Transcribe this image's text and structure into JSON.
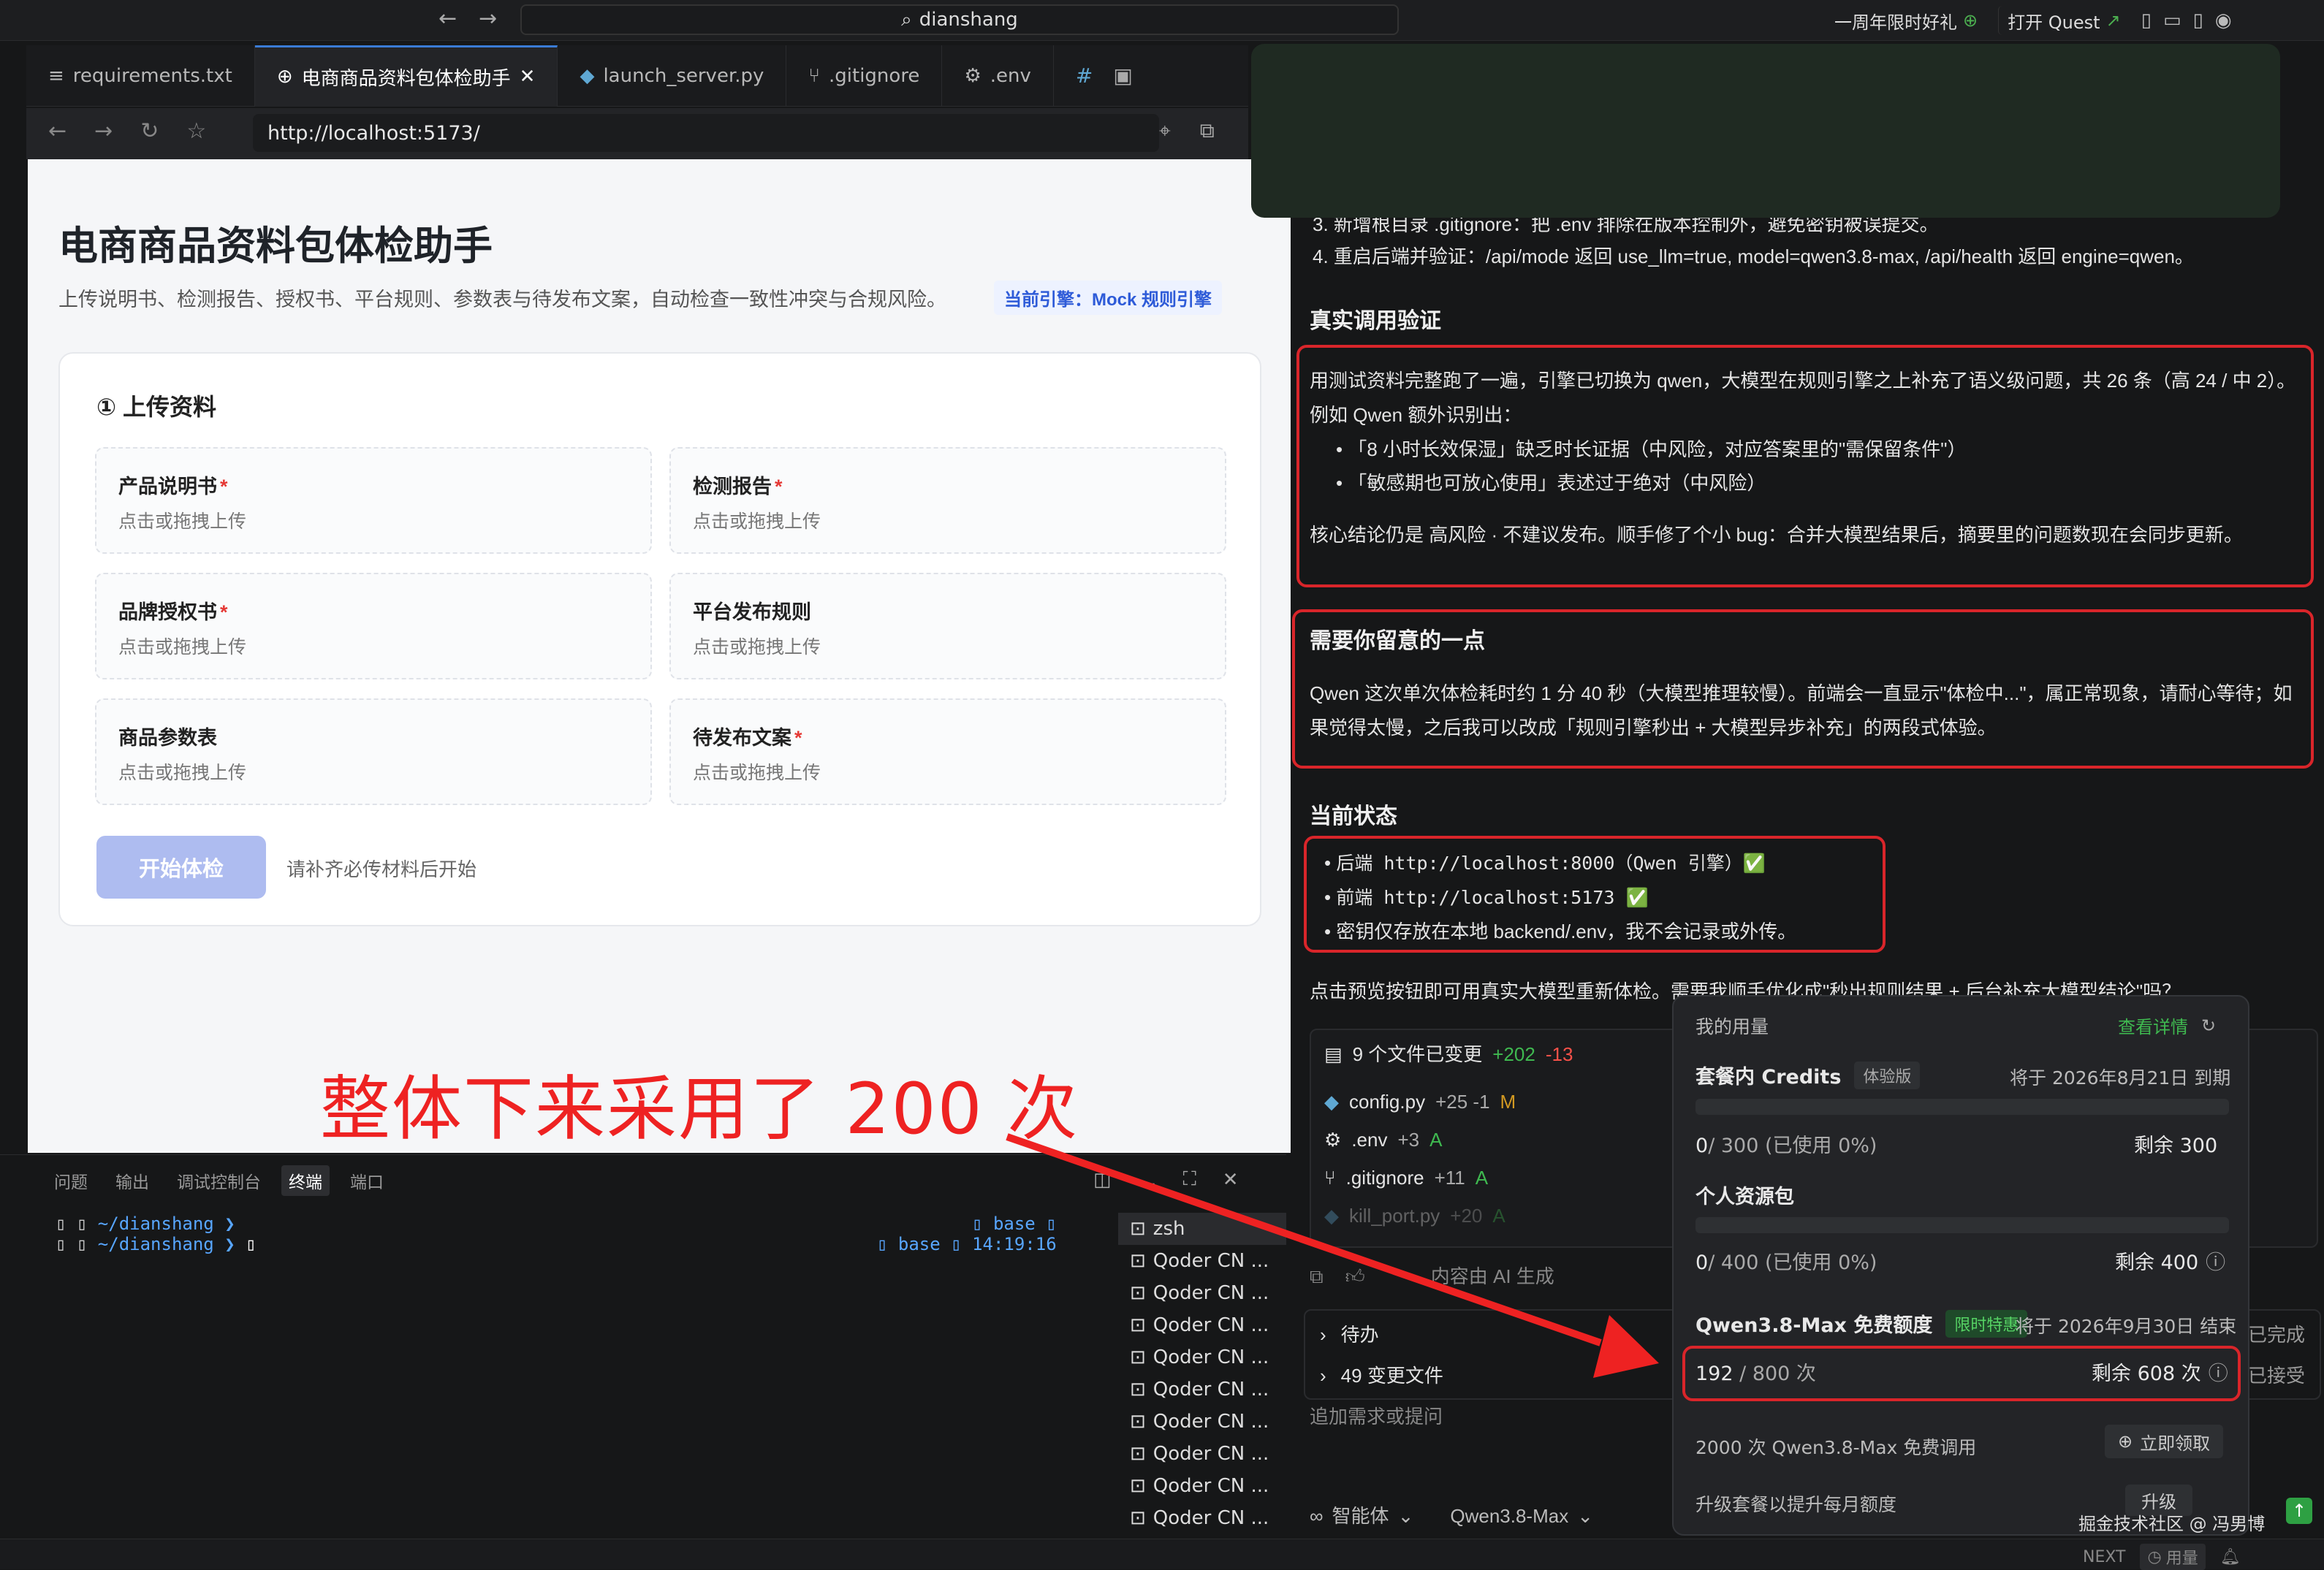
{
  "titlebar": {
    "search": "dianshang",
    "promo": "一周年限时好礼",
    "open_quest": "打开 Quest"
  },
  "tabs": [
    {
      "label": "requirements.txt"
    },
    {
      "label": "电商商品资料包体检助手"
    },
    {
      "label": "launch_server.py"
    },
    {
      "label": ".gitignore"
    },
    {
      "label": ".env"
    }
  ],
  "browser": {
    "url": "http://localhost:5173/"
  },
  "page": {
    "title": "电商商品资料包体检助手",
    "subtitle": "上传说明书、检测报告、授权书、平台规则、参数表与待发布文案，自动检查一致性冲突与合规风险。",
    "engine": "当前引擎：Mock 规则引擎",
    "upload_title": "① 上传资料",
    "uploads": [
      {
        "label": "产品说明书",
        "required": "*",
        "hint": "点击或拖拽上传"
      },
      {
        "label": "检测报告",
        "required": "*",
        "hint": "点击或拖拽上传"
      },
      {
        "label": "品牌授权书",
        "required": "*",
        "hint": "点击或拖拽上传"
      },
      {
        "label": "平台发布规则",
        "required": "",
        "hint": "点击或拖拽上传"
      },
      {
        "label": "商品参数表",
        "required": "",
        "hint": "点击或拖拽上传"
      },
      {
        "label": "待发布文案",
        "required": "*",
        "hint": "点击或拖拽上传"
      }
    ],
    "start_button": "开始体检",
    "start_hint": "请补齐必传材料后开始"
  },
  "annotation": {
    "text": "整体下来采用了 200 次"
  },
  "panel": {
    "tabs": [
      "问题",
      "输出",
      "调试控制台",
      "终端",
      "端口"
    ],
    "terminal_lines": [
      "~/dianshang ❯",
      "~/dianshang ❯"
    ],
    "prompt_base": "base",
    "prompt_time": "14:19:16",
    "terminal_list": [
      "zsh",
      "Qoder CN ...",
      "Qoder CN ...",
      "Qoder CN ...",
      "Qoder CN ...",
      "Qoder CN ...",
      "Qoder CN ...",
      "Qoder CN ...",
      "Qoder CN ...",
      "Qoder CN ..."
    ]
  },
  "chat": {
    "step3": "3. 新增根目录 .gitignore：把 .env 排除在版本控制外，避免密钥被误提交。",
    "step4": "4. 重启后端并验证：/api/mode 返回 use_llm=true, model=qwen3.8-max, /api/health 返回 engine=qwen。",
    "verify_title": "真实调用验证",
    "verify_p1": "用测试资料完整跑了一遍，引擎已切换为 qwen，大模型在规则引擎之上补充了语义级问题，共 26 条（高 24 / 中 2）。",
    "verify_p2": "例如 Qwen 额外识别出：",
    "verify_b1": "「8 小时长效保湿」缺乏时长证据（中风险，对应答案里的\"需保留条件\"）",
    "verify_b2": "「敏感期也可放心使用」表述过于绝对（中风险）",
    "verify_p3": "核心结论仍是 高风险 · 不建议发布。顺手修了个小 bug：合并大模型结果后，摘要里的问题数现在会同步更新。",
    "note_title": "需要你留意的一点",
    "note_p1": "Qwen 这次单次体检耗时约 1 分 40 秒（大模型推理较慢）。前端会一直显示\"体检中...\"，属正常现象，请耐心等待；如",
    "note_p2": "果觉得太慢，之后我可以改成「规则引擎秒出 + 大模型异步补充」的两段式体验。",
    "status_title": "当前状态",
    "status_b1": "后端 http://localhost:8000（Qwen 引擎）✅",
    "status_b2": "前端 http://localhost:5173 ✅",
    "status_b3": "密钥仅存放在本地 backend/.env，我不会记录或外传。",
    "footer_line": "点击预览按钮即可用真实大模型重新体检。需要我顺手优化成\"秒出规则结果 + 后台补充大模型结论\"吗？",
    "files_changed": "9 个文件已变更",
    "files_add": "+202",
    "files_del": "-13",
    "files": [
      {
        "name": "config.py",
        "diff": "+25 -1",
        "flag": "M"
      },
      {
        "name": ".env",
        "diff": "+3",
        "flag": "A"
      },
      {
        "name": ".gitignore",
        "diff": "+11",
        "flag": "A"
      },
      {
        "name": "kill_port.py",
        "diff": "+20",
        "flag": "A"
      }
    ],
    "ai_note": "内容由 AI 生成",
    "pending": "待办",
    "changed_files": "49 变更文件",
    "done": "已完成",
    "accepted": "已接受",
    "input_placeholder": "追加需求或提问",
    "mode": "智能体",
    "model": "Qwen3.8-Max"
  },
  "usage": {
    "title": "我的用量",
    "detail": "查看详情",
    "plan_title": "套餐内 Credits",
    "plan_badge": "体验版",
    "plan_expire": "将于 2026年8月21日 到期",
    "plan_used": "0",
    "plan_total": "/ 300 (已使用 0%)",
    "plan_remain": "剩余 300",
    "pack_title": "个人资源包",
    "pack_used": "0",
    "pack_total": "/ 400 (已使用 0%)",
    "pack_remain": "剩余 400",
    "free_title": "Qwen3.8-Max 免费额度",
    "free_badge": "限时特惠",
    "free_expire": "将于 2026年9月30日 结束",
    "free_used": "192",
    "free_total": "/ 800 次",
    "free_used_fraction": 0.24,
    "free_remain": "剩余 608 次",
    "offer": "2000 次 Qwen3.8-Max 免费调用",
    "claim": "立即领取",
    "upgrade_text": "升级套餐以提升每月额度",
    "upgrade_btn": "升级"
  },
  "statusbar": {
    "next": "NEXT",
    "usage": "用量",
    "watermark": "掘金技术社区 @ 冯男博"
  },
  "colors": {
    "accent": "#3a7bd5",
    "red_annotation": "#ee2222",
    "green_badge": "#2ea043"
  }
}
